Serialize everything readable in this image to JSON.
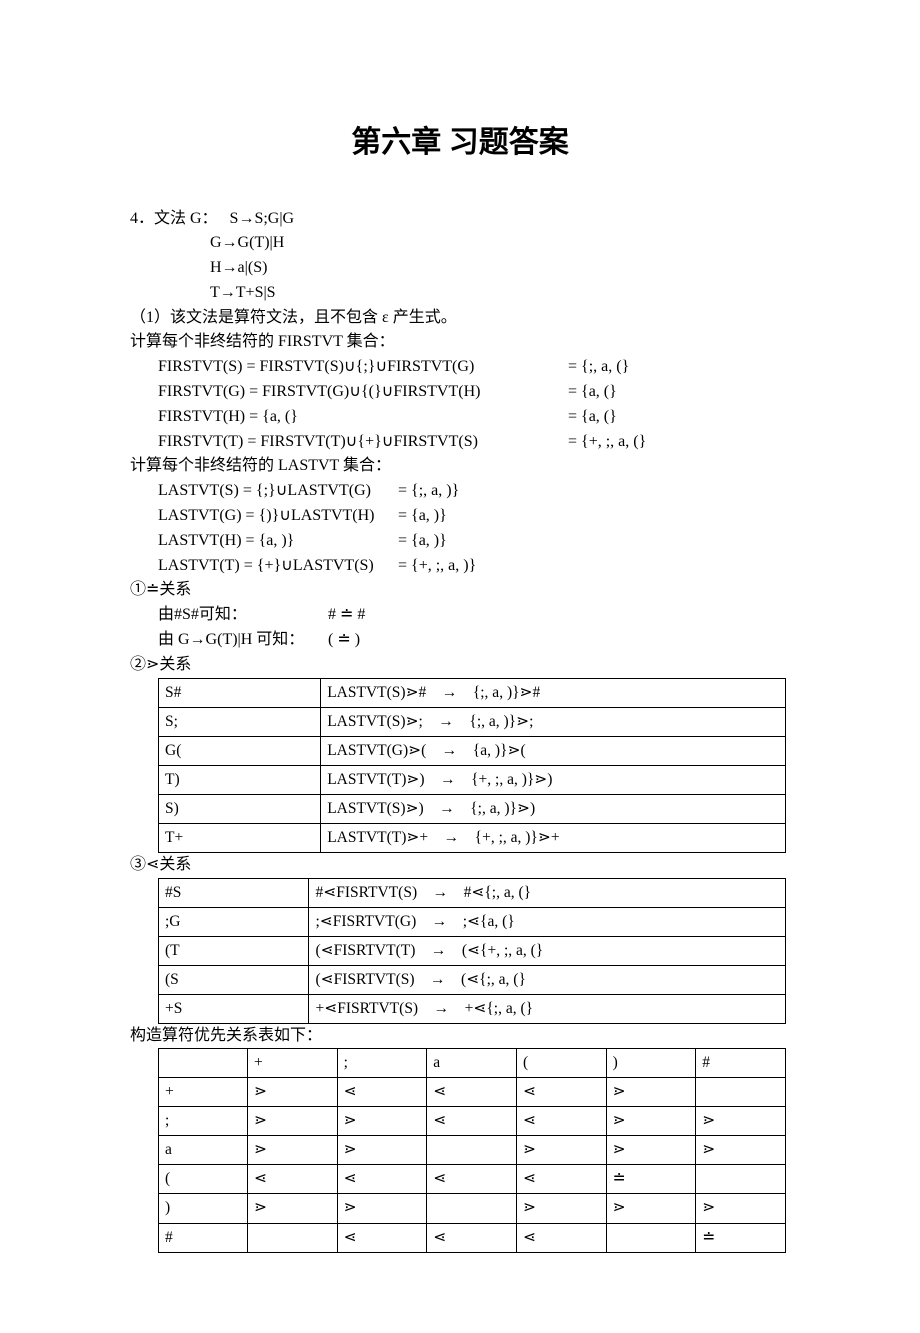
{
  "title": "第六章  习题答案",
  "q4_header": "4．文法 G：   S→S;G|G",
  "grammar_rules": [
    "G→G(T)|H",
    "H→a|(S)",
    "T→T+S|S"
  ],
  "note1": "（1）该文法是算符文法，且不包含 ε 产生式。",
  "firstvt_header": "计算每个非终结符的 FIRSTVT 集合：",
  "firstvt": [
    {
      "left": "FIRSTVT(S) = FIRSTVT(S)∪{;}∪FIRSTVT(G)",
      "right": "= {;, a, (}"
    },
    {
      "left": "FIRSTVT(G) = FIRSTVT(G)∪{(}∪FIRSTVT(H)",
      "right": "= {a, (}"
    },
    {
      "left": "FIRSTVT(H) = {a, (}",
      "right": "= {a, (}"
    },
    {
      "left": "FIRSTVT(T) = FIRSTVT(T)∪{+}∪FIRSTVT(S)",
      "right": "= {+, ;, a, (}"
    }
  ],
  "lastvt_header": "计算每个非终结符的 LASTVT 集合：",
  "lastvt": [
    {
      "left": "LASTVT(S) = {;}∪LASTVT(G)",
      "right": "= {;, a, )}"
    },
    {
      "left": "LASTVT(G) = {)}∪LASTVT(H)",
      "right": "= {a, )}"
    },
    {
      "left": "LASTVT(H) = {a, )}",
      "right": "= {a, )}"
    },
    {
      "left": "LASTVT(T) = {+}∪LASTVT(S)",
      "right": "= {+, ;, a, )}"
    }
  ],
  "eq_header": "①≐关系",
  "eq_items": [
    {
      "l": "由#S#可知：",
      "r": "# ≐ #"
    },
    {
      "l": "由 G→G(T)|H 可知：",
      "r": "( ≐ )"
    }
  ],
  "gt_header": "②⋗关系",
  "gt_rows": [
    {
      "c1": "S#",
      "c2": "LASTVT(S)⋗#",
      "arr": "→",
      "c4": "{;, a, )}⋗#"
    },
    {
      "c1": "S;",
      "c2": "LASTVT(S)⋗;",
      "arr": "→",
      "c4": "{;, a, )}⋗;"
    },
    {
      "c1": "G(",
      "c2": "LASTVT(G)⋗(",
      "arr": "→",
      "c4": "{a, )}⋗("
    },
    {
      "c1": "T)",
      "c2": "LASTVT(T)⋗)",
      "arr": "→",
      "c4": "{+, ;, a, )}⋗)"
    },
    {
      "c1": "S)",
      "c2": "LASTVT(S)⋗)",
      "arr": "→",
      "c4": "{;, a, )}⋗)"
    },
    {
      "c1": "T+",
      "c2": "LASTVT(T)⋗+",
      "arr": "→",
      "c4": "{+, ;, a, )}⋗+"
    }
  ],
  "lt_header": "③⋖关系",
  "lt_rows": [
    {
      "c1": "#S",
      "c2": "#⋖FISRTVT(S)",
      "arr": "→",
      "c4": "#⋖{;, a, (}"
    },
    {
      "c1": ";G",
      "c2": ";⋖FISRTVT(G)",
      "arr": "→",
      "c4": ";⋖{a, (}"
    },
    {
      "c1": "(T",
      "c2": "(⋖FISRTVT(T)",
      "arr": "→",
      "c4": "(⋖{+, ;, a, (}"
    },
    {
      "c1": "(S",
      "c2": "(⋖FISRTVT(S)",
      "arr": "→",
      "c4": "(⋖{;, a, (}"
    },
    {
      "c1": "+S",
      "c2": "+⋖FISRTVT(S)",
      "arr": "→",
      "c4": "+⋖{;, a, (}"
    }
  ],
  "prec_header": "构造算符优先关系表如下：",
  "prec_table": {
    "cols": [
      "",
      "+",
      ";",
      "a",
      "(",
      ")",
      "#"
    ],
    "rows": [
      {
        "h": "+",
        "cells": [
          "⋗",
          "⋖",
          "⋖",
          "⋖",
          "⋗",
          ""
        ]
      },
      {
        "h": ";",
        "cells": [
          "⋗",
          "⋗",
          "⋖",
          "⋖",
          "⋗",
          "⋗"
        ]
      },
      {
        "h": "a",
        "cells": [
          "⋗",
          "⋗",
          "",
          "⋗",
          "⋗",
          "⋗"
        ]
      },
      {
        "h": "(",
        "cells": [
          "⋖",
          "⋖",
          "⋖",
          "⋖",
          "≐",
          ""
        ]
      },
      {
        "h": ")",
        "cells": [
          "⋗",
          "⋗",
          "",
          "⋗",
          "⋗",
          "⋗"
        ]
      },
      {
        "h": "#",
        "cells": [
          "",
          "⋖",
          "⋖",
          "⋖",
          "",
          "≐"
        ]
      }
    ]
  }
}
